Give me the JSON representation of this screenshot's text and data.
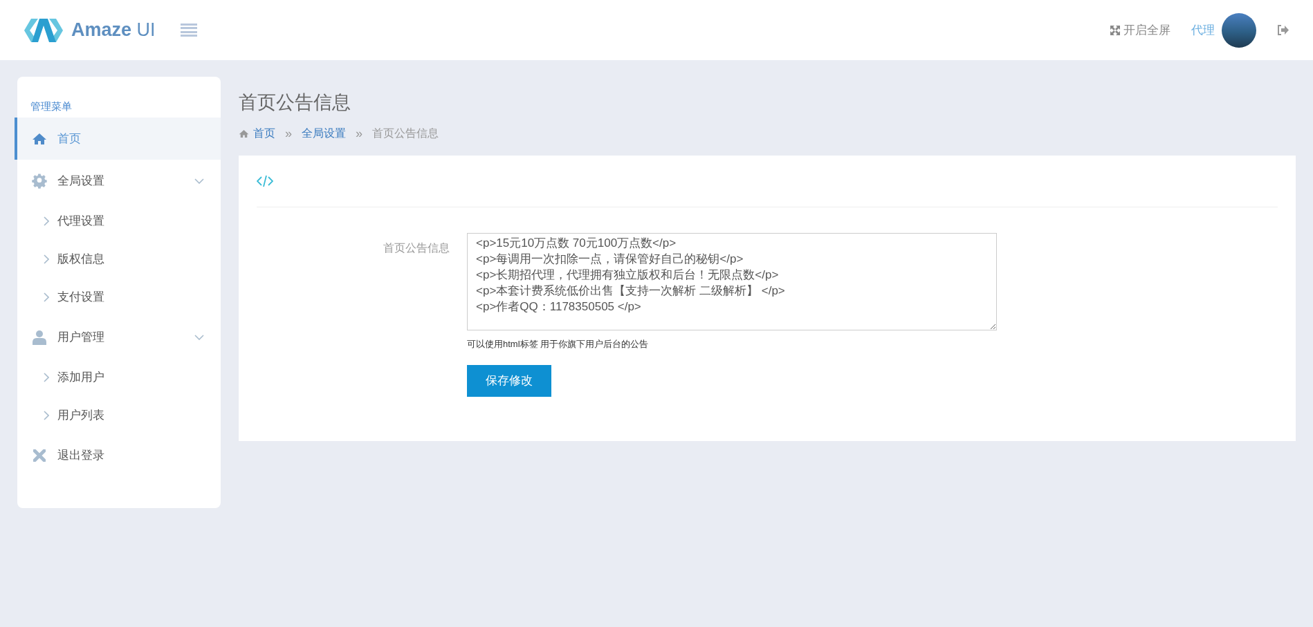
{
  "header": {
    "logo_text": "Amaze",
    "logo_suffix": "UI",
    "fullscreen_label": "开启全屏",
    "user_name": "代理"
  },
  "sidebar": {
    "title": "管理菜单",
    "items": [
      {
        "kind": "link",
        "label": "首页",
        "selected": true
      },
      {
        "kind": "group",
        "label": "全局设置",
        "expanded": true,
        "children": [
          {
            "label": "代理设置"
          },
          {
            "label": "版权信息"
          },
          {
            "label": "支付设置"
          }
        ]
      },
      {
        "kind": "group",
        "label": "用户管理",
        "expanded": true,
        "children": [
          {
            "label": "添加用户"
          },
          {
            "label": "用户列表"
          }
        ]
      },
      {
        "kind": "link",
        "label": "退出登录",
        "selected": false
      }
    ]
  },
  "page": {
    "title": "首页公告信息",
    "breadcrumb": [
      {
        "label": "首页",
        "link": true
      },
      {
        "separator": "»",
        "label": "全局设置",
        "link": true
      },
      {
        "separator": "»",
        "label": "首页公告信息",
        "link": false
      }
    ]
  },
  "form": {
    "label": "首页公告信息",
    "value": "<p>15元10万点数 70元100万点数</p>\n<p>每调用一次扣除一点，请保管好自己的秘钥</p>\n<p>长期招代理，代理拥有独立版权和后台！无限点数</p>\n<p>本套计费系统低价出售【支持一次解析 二级解析】 </p>\n<p>作者QQ：1178350505 </p>",
    "hint": "可以使用html标签 用于你旗下用户后台的公告",
    "button": "保存修改"
  }
}
